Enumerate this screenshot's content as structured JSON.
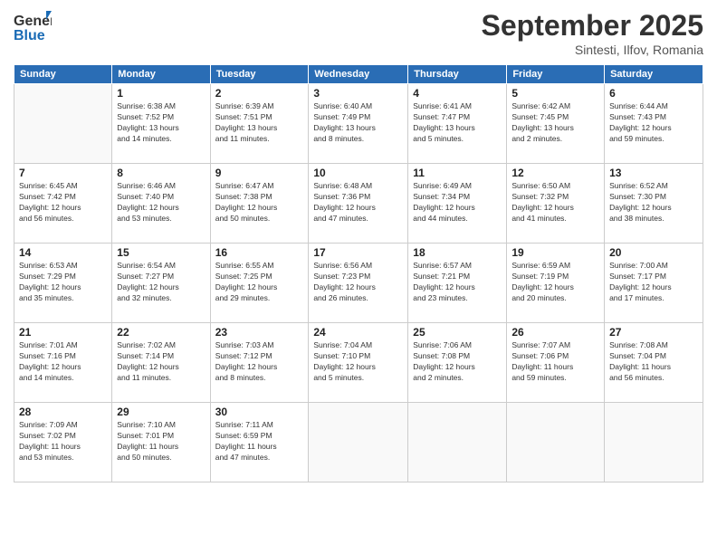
{
  "logo": {
    "general": "General",
    "blue": "Blue"
  },
  "header": {
    "month": "September 2025",
    "location": "Sintesti, Ilfov, Romania"
  },
  "days_of_week": [
    "Sunday",
    "Monday",
    "Tuesday",
    "Wednesday",
    "Thursday",
    "Friday",
    "Saturday"
  ],
  "weeks": [
    [
      {
        "day": "",
        "info": ""
      },
      {
        "day": "1",
        "info": "Sunrise: 6:38 AM\nSunset: 7:52 PM\nDaylight: 13 hours\nand 14 minutes."
      },
      {
        "day": "2",
        "info": "Sunrise: 6:39 AM\nSunset: 7:51 PM\nDaylight: 13 hours\nand 11 minutes."
      },
      {
        "day": "3",
        "info": "Sunrise: 6:40 AM\nSunset: 7:49 PM\nDaylight: 13 hours\nand 8 minutes."
      },
      {
        "day": "4",
        "info": "Sunrise: 6:41 AM\nSunset: 7:47 PM\nDaylight: 13 hours\nand 5 minutes."
      },
      {
        "day": "5",
        "info": "Sunrise: 6:42 AM\nSunset: 7:45 PM\nDaylight: 13 hours\nand 2 minutes."
      },
      {
        "day": "6",
        "info": "Sunrise: 6:44 AM\nSunset: 7:43 PM\nDaylight: 12 hours\nand 59 minutes."
      }
    ],
    [
      {
        "day": "7",
        "info": "Sunrise: 6:45 AM\nSunset: 7:42 PM\nDaylight: 12 hours\nand 56 minutes."
      },
      {
        "day": "8",
        "info": "Sunrise: 6:46 AM\nSunset: 7:40 PM\nDaylight: 12 hours\nand 53 minutes."
      },
      {
        "day": "9",
        "info": "Sunrise: 6:47 AM\nSunset: 7:38 PM\nDaylight: 12 hours\nand 50 minutes."
      },
      {
        "day": "10",
        "info": "Sunrise: 6:48 AM\nSunset: 7:36 PM\nDaylight: 12 hours\nand 47 minutes."
      },
      {
        "day": "11",
        "info": "Sunrise: 6:49 AM\nSunset: 7:34 PM\nDaylight: 12 hours\nand 44 minutes."
      },
      {
        "day": "12",
        "info": "Sunrise: 6:50 AM\nSunset: 7:32 PM\nDaylight: 12 hours\nand 41 minutes."
      },
      {
        "day": "13",
        "info": "Sunrise: 6:52 AM\nSunset: 7:30 PM\nDaylight: 12 hours\nand 38 minutes."
      }
    ],
    [
      {
        "day": "14",
        "info": "Sunrise: 6:53 AM\nSunset: 7:29 PM\nDaylight: 12 hours\nand 35 minutes."
      },
      {
        "day": "15",
        "info": "Sunrise: 6:54 AM\nSunset: 7:27 PM\nDaylight: 12 hours\nand 32 minutes."
      },
      {
        "day": "16",
        "info": "Sunrise: 6:55 AM\nSunset: 7:25 PM\nDaylight: 12 hours\nand 29 minutes."
      },
      {
        "day": "17",
        "info": "Sunrise: 6:56 AM\nSunset: 7:23 PM\nDaylight: 12 hours\nand 26 minutes."
      },
      {
        "day": "18",
        "info": "Sunrise: 6:57 AM\nSunset: 7:21 PM\nDaylight: 12 hours\nand 23 minutes."
      },
      {
        "day": "19",
        "info": "Sunrise: 6:59 AM\nSunset: 7:19 PM\nDaylight: 12 hours\nand 20 minutes."
      },
      {
        "day": "20",
        "info": "Sunrise: 7:00 AM\nSunset: 7:17 PM\nDaylight: 12 hours\nand 17 minutes."
      }
    ],
    [
      {
        "day": "21",
        "info": "Sunrise: 7:01 AM\nSunset: 7:16 PM\nDaylight: 12 hours\nand 14 minutes."
      },
      {
        "day": "22",
        "info": "Sunrise: 7:02 AM\nSunset: 7:14 PM\nDaylight: 12 hours\nand 11 minutes."
      },
      {
        "day": "23",
        "info": "Sunrise: 7:03 AM\nSunset: 7:12 PM\nDaylight: 12 hours\nand 8 minutes."
      },
      {
        "day": "24",
        "info": "Sunrise: 7:04 AM\nSunset: 7:10 PM\nDaylight: 12 hours\nand 5 minutes."
      },
      {
        "day": "25",
        "info": "Sunrise: 7:06 AM\nSunset: 7:08 PM\nDaylight: 12 hours\nand 2 minutes."
      },
      {
        "day": "26",
        "info": "Sunrise: 7:07 AM\nSunset: 7:06 PM\nDaylight: 11 hours\nand 59 minutes."
      },
      {
        "day": "27",
        "info": "Sunrise: 7:08 AM\nSunset: 7:04 PM\nDaylight: 11 hours\nand 56 minutes."
      }
    ],
    [
      {
        "day": "28",
        "info": "Sunrise: 7:09 AM\nSunset: 7:02 PM\nDaylight: 11 hours\nand 53 minutes."
      },
      {
        "day": "29",
        "info": "Sunrise: 7:10 AM\nSunset: 7:01 PM\nDaylight: 11 hours\nand 50 minutes."
      },
      {
        "day": "30",
        "info": "Sunrise: 7:11 AM\nSunset: 6:59 PM\nDaylight: 11 hours\nand 47 minutes."
      },
      {
        "day": "",
        "info": ""
      },
      {
        "day": "",
        "info": ""
      },
      {
        "day": "",
        "info": ""
      },
      {
        "day": "",
        "info": ""
      }
    ]
  ]
}
